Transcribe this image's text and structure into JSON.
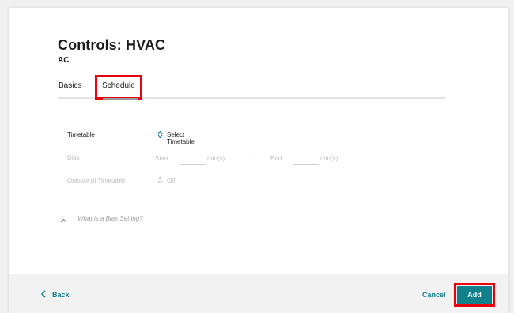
{
  "header": {
    "title": "Controls: HVAC",
    "subtitle": "AC"
  },
  "tabs": [
    {
      "label": "Basics"
    },
    {
      "label": "Schedule"
    }
  ],
  "form": {
    "timetable": {
      "label": "Timetable",
      "value": "Select Timetable"
    },
    "bias": {
      "label": "Bias",
      "start_label": "Start",
      "start_unit": "min(s)",
      "separator": ":",
      "end_label": "End",
      "end_unit": "min(s)"
    },
    "outside": {
      "label": "Outside of Timetable",
      "value": "Off"
    }
  },
  "help": {
    "text": "What is a Bias Setting?"
  },
  "footer": {
    "back_label": "Back",
    "cancel_label": "Cancel",
    "add_label": "Add"
  },
  "colors": {
    "accent": "#10808b",
    "highlight": "#e8000b"
  },
  "icons": [
    "select-arrows-icon",
    "chevron-up-icon",
    "chevron-left-icon"
  ]
}
